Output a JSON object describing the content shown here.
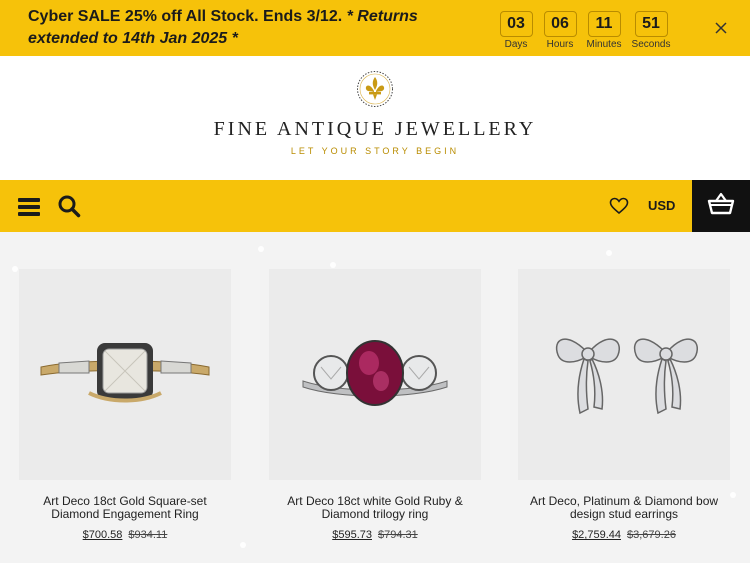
{
  "promo": {
    "text_main": "Cyber SALE 25% off All Stock. Ends 3/12.",
    "text_em": "* Returns extended to 14th Jan 2025 *",
    "countdown": [
      {
        "value": "03",
        "label": "Days"
      },
      {
        "value": "06",
        "label": "Hours"
      },
      {
        "value": "11",
        "label": "Minutes"
      },
      {
        "value": "51",
        "label": "Seconds"
      }
    ]
  },
  "header": {
    "brand": "FINE ANTIQUE JEWELLERY",
    "tagline": "LET YOUR STORY BEGIN",
    "logo_icon": "fleur-de-lis-icon"
  },
  "nav": {
    "currency": "USD",
    "icons": [
      "menu-icon",
      "search-icon",
      "heart-icon",
      "basket-icon"
    ]
  },
  "colors": {
    "accent": "#f6c20a",
    "dark": "#111111",
    "gold_text": "#b98c00"
  },
  "products": [
    {
      "name": "Art Deco 18ct Gold Square-set Diamond Engagement Ring",
      "price": "$700.58",
      "old_price": "$934.11"
    },
    {
      "name": "Art Deco 18ct white Gold Ruby & Diamond trilogy ring",
      "price": "$595.73",
      "old_price": "$794.31"
    },
    {
      "name": "Art Deco, Platinum & Diamond bow design stud earrings",
      "price": "$2,759.44",
      "old_price": "$3,679.26"
    }
  ]
}
